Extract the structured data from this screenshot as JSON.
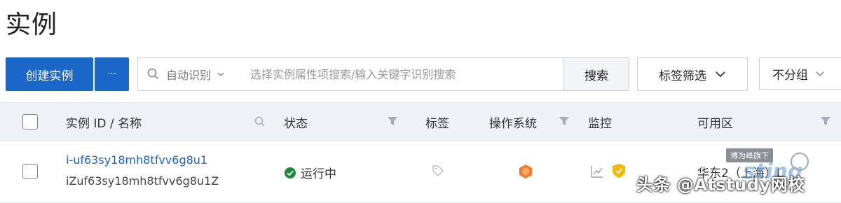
{
  "page_title": "实例",
  "toolbar": {
    "create_label": "创建实例",
    "more_label": "···",
    "search_mode": "自动识别",
    "search_placeholder": "选择实例属性项搜索/输入关键字识别搜索",
    "search_button": "搜索",
    "tag_filter": "标签筛选",
    "group_select": "不分组"
  },
  "table": {
    "columns": [
      "实例 ID / 名称",
      "状态",
      "标签",
      "操作系统",
      "监控",
      "可用区"
    ],
    "rows": [
      {
        "instance_id": "i-uf63sy18mh8tfvv6g8u1",
        "name": "iZuf63sy18mh8tfvv6g8u1Z",
        "status": "运行中",
        "zone": "华东2（上海）L"
      }
    ]
  },
  "watermark": {
    "tag": "博为峰旗下",
    "text": "头条 @Atstudy网校",
    "logo": "sting"
  },
  "colors": {
    "primary": "#1a66c9",
    "status_ok": "#1f8a3b",
    "os_icon": "#f07a2a",
    "monitor_badge": "#f5b800"
  }
}
